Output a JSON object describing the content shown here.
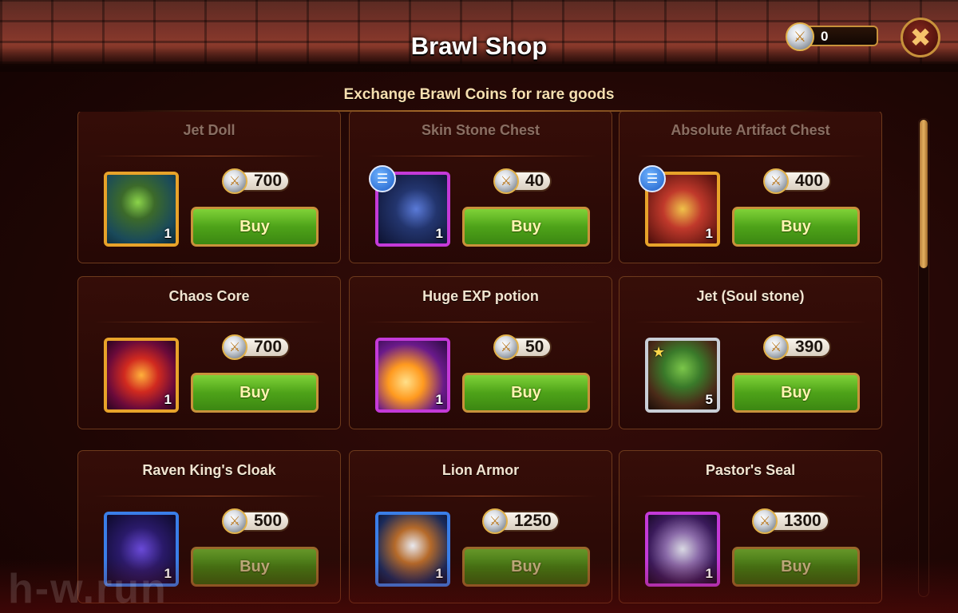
{
  "header": {
    "title": "Brawl Shop",
    "subtitle": "Exchange Brawl Coins for rare goods",
    "currency": {
      "icon": "brawl-coin-icon",
      "value": "0"
    },
    "close_icon": "close-icon"
  },
  "shop": {
    "items": [
      {
        "name": "Jet Doll",
        "price": "700",
        "qty": "1",
        "buy_label": "Buy",
        "frame": "gold"
      },
      {
        "name": "Skin Stone Chest",
        "price": "40",
        "qty": "1",
        "buy_label": "Buy",
        "frame": "purple",
        "info_icon": "list-info-icon"
      },
      {
        "name": "Absolute Artifact Chest",
        "price": "400",
        "qty": "1",
        "buy_label": "Buy",
        "frame": "gold",
        "info_icon": "list-info-icon"
      },
      {
        "name": "Chaos Core",
        "price": "700",
        "qty": "1",
        "buy_label": "Buy",
        "frame": "gold"
      },
      {
        "name": "Huge EXP potion",
        "price": "50",
        "qty": "1",
        "buy_label": "Buy",
        "frame": "purple"
      },
      {
        "name": "Jet (Soul stone)",
        "price": "390",
        "qty": "5",
        "buy_label": "Buy",
        "frame": "silver"
      },
      {
        "name": "Raven King's Cloak",
        "price": "500",
        "qty": "1",
        "buy_label": "Buy",
        "frame": "blue"
      },
      {
        "name": "Lion Armor",
        "price": "1250",
        "qty": "1",
        "buy_label": "Buy",
        "frame": "blue"
      },
      {
        "name": "Pastor's Seal",
        "price": "1300",
        "qty": "1",
        "buy_label": "Buy",
        "frame": "purple"
      }
    ]
  },
  "watermark": "h-w.run",
  "colors": {
    "buy_green": "#4ea319",
    "gold_frame": "#e8a32a",
    "purple_frame": "#c43ad8",
    "blue_frame": "#3a7ee8"
  }
}
